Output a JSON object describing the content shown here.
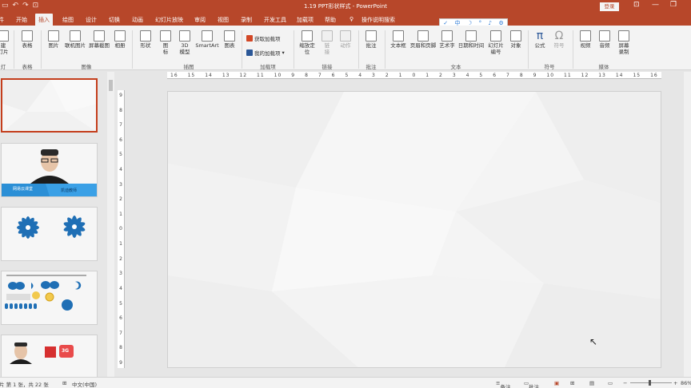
{
  "title_bar": {
    "document_title": "1.19 PPT形状样式 - PowerPoint",
    "login_button": "登录",
    "quick_access": [
      "save-icon",
      "undo-icon",
      "redo-icon",
      "start-icon"
    ]
  },
  "tabs": [
    {
      "label": "件"
    },
    {
      "label": "开始"
    },
    {
      "label": "插入",
      "active": true
    },
    {
      "label": "绘图"
    },
    {
      "label": "设计"
    },
    {
      "label": "切换"
    },
    {
      "label": "动画"
    },
    {
      "label": "幻灯片放映"
    },
    {
      "label": "审阅"
    },
    {
      "label": "视图"
    },
    {
      "label": "录制"
    },
    {
      "label": "开发工具"
    },
    {
      "label": "加载项"
    },
    {
      "label": "帮助"
    },
    {
      "label": "操作说明搜索"
    }
  ],
  "ime_toolbar": [
    "✓",
    "中",
    "☽",
    "°",
    "♪",
    "⚙"
  ],
  "ribbon": {
    "buttons": [
      {
        "id": "new-slide",
        "label": "建\n灯片",
        "group": "slides"
      },
      {
        "id": "table",
        "label": "表格",
        "group": "tables"
      },
      {
        "id": "pictures",
        "label": "图片",
        "group": "images"
      },
      {
        "id": "online-pictures",
        "label": "联机图片",
        "group": "images"
      },
      {
        "id": "screenshot",
        "label": "屏幕截图",
        "group": "images"
      },
      {
        "id": "album",
        "label": "相册",
        "group": "images"
      },
      {
        "id": "shapes",
        "label": "形状",
        "group": "illustrations"
      },
      {
        "id": "icons",
        "label": "图\n标",
        "group": "illustrations"
      },
      {
        "id": "3d-models",
        "label": "3D\n模型",
        "group": "illustrations"
      },
      {
        "id": "smartart",
        "label": "SmartArt",
        "group": "illustrations"
      },
      {
        "id": "chart",
        "label": "图表",
        "group": "illustrations"
      },
      {
        "id": "zoom",
        "label": "缩放定\n位",
        "group": "links"
      },
      {
        "id": "link",
        "label": "链\n接",
        "group": "links",
        "disabled": true
      },
      {
        "id": "action",
        "label": "动作",
        "group": "links",
        "disabled": true
      },
      {
        "id": "comment",
        "label": "批注",
        "group": "comments"
      },
      {
        "id": "textbox",
        "label": "文本框",
        "group": "text"
      },
      {
        "id": "header-footer",
        "label": "页眉和页脚",
        "group": "text"
      },
      {
        "id": "wordart",
        "label": "艺术字",
        "group": "text"
      },
      {
        "id": "date-time",
        "label": "日期和时间",
        "group": "text"
      },
      {
        "id": "slide-number",
        "label": "幻灯片\n编号",
        "group": "text"
      },
      {
        "id": "object",
        "label": "对象",
        "group": "text"
      },
      {
        "id": "equation",
        "label": "公式",
        "group": "symbols"
      },
      {
        "id": "symbol",
        "label": "符号",
        "group": "symbols",
        "disabled": true
      },
      {
        "id": "video",
        "label": "视频",
        "group": "media"
      },
      {
        "id": "audio",
        "label": "音频",
        "group": "media"
      },
      {
        "id": "screen-recording",
        "label": "屏幕\n录制",
        "group": "media"
      }
    ],
    "addins": {
      "get": "获取加载项",
      "mine": "我的加载项"
    },
    "groups": [
      {
        "label": "灯片"
      },
      {
        "label": "表格"
      },
      {
        "label": "图像"
      },
      {
        "label": "插图"
      },
      {
        "label": "加载项"
      },
      {
        "label": "链接"
      },
      {
        "label": "批注"
      },
      {
        "label": "文本"
      },
      {
        "label": "符号"
      },
      {
        "label": "媒体"
      }
    ]
  },
  "ruler": {
    "h": [
      "16",
      "15",
      "14",
      "13",
      "12",
      "11",
      "10",
      "9",
      "8",
      "7",
      "6",
      "5",
      "4",
      "3",
      "2",
      "1",
      "0",
      "1",
      "2",
      "3",
      "4",
      "5",
      "6",
      "7",
      "8",
      "9",
      "10",
      "11",
      "12",
      "13",
      "14",
      "15",
      "16"
    ],
    "v": [
      "9",
      "8",
      "7",
      "6",
      "5",
      "4",
      "3",
      "2",
      "1",
      "0",
      "1",
      "2",
      "3",
      "4",
      "5",
      "6",
      "7",
      "8",
      "9"
    ]
  },
  "thumbnails": {
    "slide2_labels": [
      "网易云课堂",
      "凯迪教师"
    ],
    "slide5_badge": "3G"
  },
  "status": {
    "slide_info": "片 第 1 张，共 22 张",
    "language": "中文(中国)",
    "notes": "备注",
    "comments": "批注",
    "zoom": "86%"
  },
  "colors": {
    "accent": "#b7472a",
    "selection": "#c43e1c",
    "thumb_blue": "#1f6fb5"
  }
}
